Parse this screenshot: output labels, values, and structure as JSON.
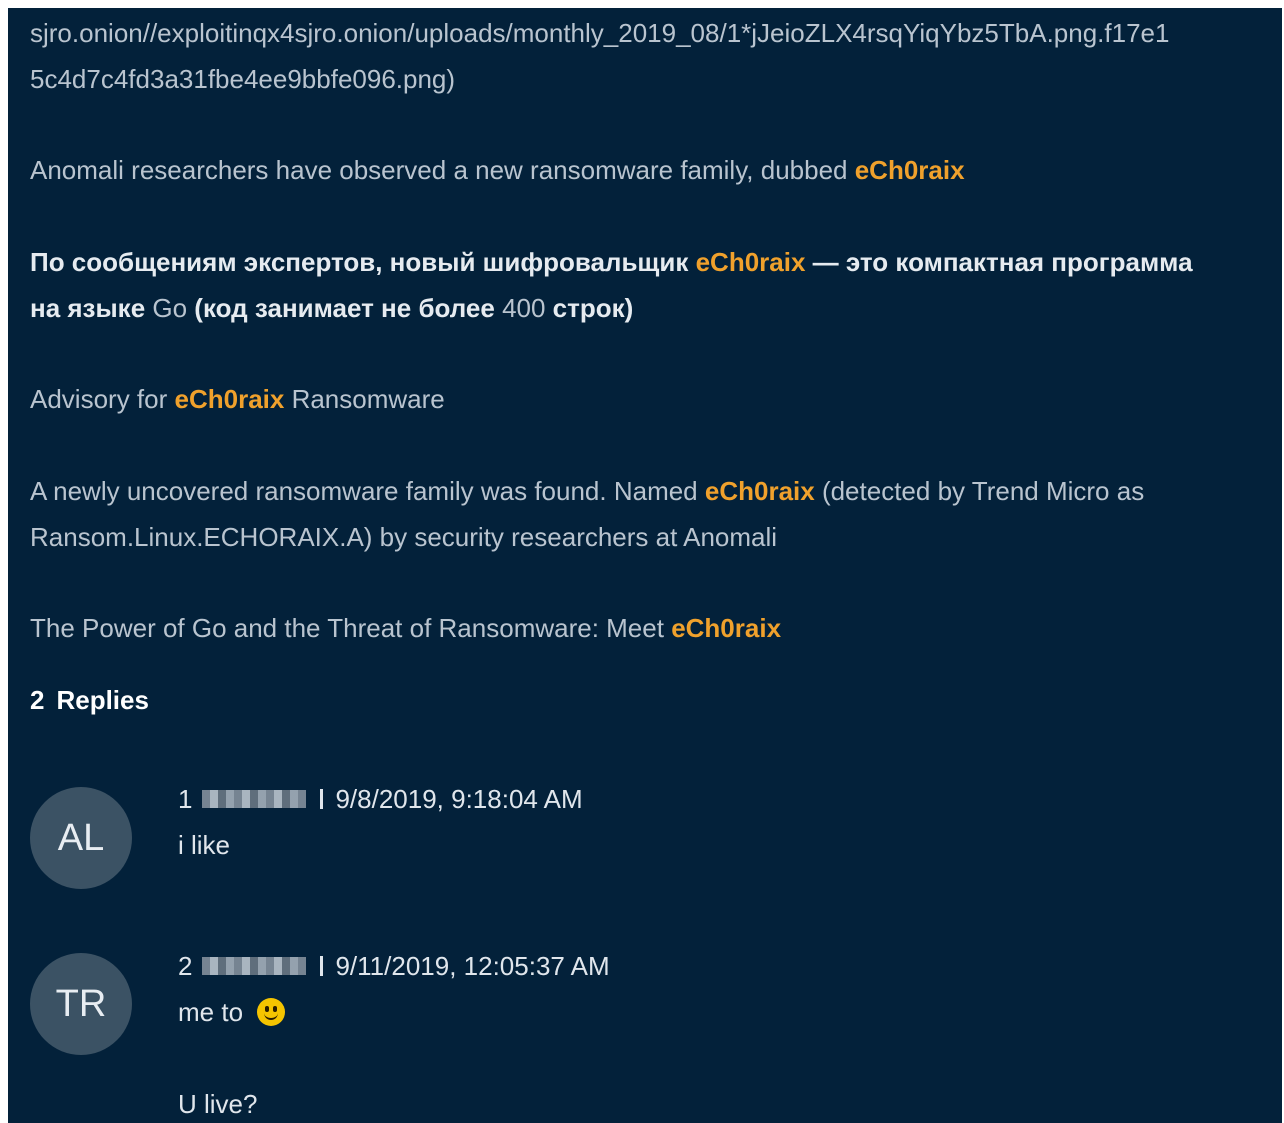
{
  "post": {
    "url_line1": "sjro.onion//exploitinqx4sjro.onion/uploads/monthly_2019_08/1*jJeioZLX4rsqYiqYbz5TbA.png.f17e1",
    "url_line2": "5c4d7c4fd3a31fbe4ee9bbfe096.png)",
    "p1": {
      "text": "Anomali researchers have observed a new ransomware family, dubbed ",
      "hl": "eCh0raix"
    },
    "p2": {
      "a": "По сообщениям экспертов, новый шифровальщик ",
      "hl": "eCh0raix",
      "b": " — это компактная программа",
      "c": "на языке ",
      "d": "Go",
      "e": " (код занимает не более ",
      "f": "400",
      "g": " строк)"
    },
    "p3": {
      "a": "Advisory for ",
      "hl": "eCh0raix",
      "b": " Ransomware"
    },
    "p4": {
      "a": "A newly uncovered ransomware family was found. Named ",
      "hl": "eCh0raix",
      "b": " (detected by Trend Micro as",
      "c": "Ransom.Linux.ECHORAIX.A) by security researchers at Anomali"
    },
    "p5": {
      "a": "The Power of Go and the Threat of Ransomware: Meet ",
      "hl": "eCh0raix"
    }
  },
  "replies": {
    "count": "2",
    "label": "Replies",
    "items": [
      {
        "avatar": "AL",
        "index": "1",
        "timestamp": "9/8/2019, 9:18:04 AM",
        "text": "i like"
      },
      {
        "avatar": "TR",
        "index": "2",
        "timestamp": "9/11/2019, 12:05:37 AM",
        "text": "me to",
        "emoji": "smiley-emoji",
        "text2": "U live?"
      }
    ]
  },
  "colors": {
    "background": "#03213a",
    "highlight": "#f0a12c",
    "body_text": "#b9c4cf",
    "avatar_bg": "#3b5264"
  }
}
